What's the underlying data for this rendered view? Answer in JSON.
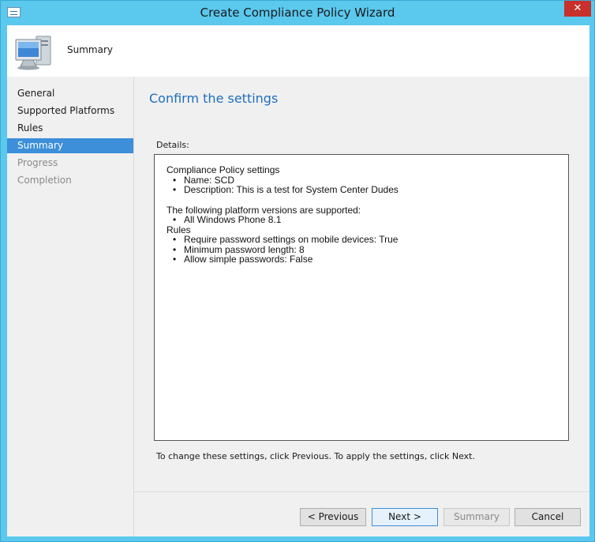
{
  "window": {
    "title": "Create Compliance Policy Wizard",
    "close_glyph": "✕"
  },
  "header": {
    "title": "Summary"
  },
  "nav": {
    "items": [
      {
        "label": "General"
      },
      {
        "label": "Supported Platforms"
      },
      {
        "label": "Rules"
      },
      {
        "label": "Summary"
      },
      {
        "label": "Progress"
      },
      {
        "label": "Completion"
      }
    ]
  },
  "main": {
    "heading": "Confirm the settings",
    "details_label": "Details:",
    "details": {
      "section1_title": "Compliance Policy settings",
      "name": "Name: SCD",
      "description": "Description: This is a test for System Center Dudes",
      "section2_title": "The following platform versions are supported:",
      "platform": "All Windows Phone 8.1",
      "section3_title": "Rules",
      "rule1": "Require password settings on mobile devices: True",
      "rule2": "Minimum password length: 8",
      "rule3": "Allow simple passwords: False"
    },
    "footer_note": "To change these settings, click Previous. To apply the settings, click Next."
  },
  "buttons": {
    "previous": "< Previous",
    "next": "Next >",
    "summary": "Summary",
    "cancel": "Cancel"
  },
  "colors": {
    "titlebar": "#5bc8ee",
    "accent": "#3c8fd8",
    "heading": "#1e6fbe",
    "close": "#c7302b"
  }
}
